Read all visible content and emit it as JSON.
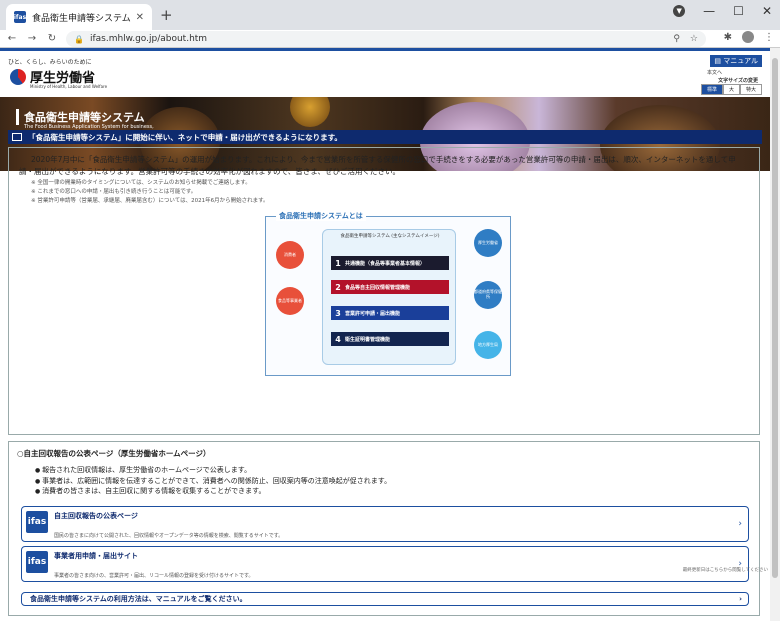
{
  "browser": {
    "tab_title": "食品衛生申請等システム",
    "url": "ifas.mhlw.go.jp/about.htm",
    "favicon_text": "ifas"
  },
  "header": {
    "tagline": "ひと、くらし、みらいのために",
    "logo_name": "厚生労働省",
    "logo_en": "Ministry of Health, Labour and Welfare",
    "manual": "マニュアル",
    "honbun": "本文へ",
    "font_size_label": "文字サイズの変更",
    "sizes": [
      "標準",
      "大",
      "特大"
    ]
  },
  "banner": {
    "title": "食品衛生申請等システム",
    "sub": "The Food Business Application System for business, expert certificates and report of food recall"
  },
  "notice": "「食品衛生申請等システム」に開始に伴い、ネットで申請・届け出ができるようになります。",
  "intro": "2020年7月中に「食品衛生申請等システム」の運用が始まります。これにより、今まで営業所を所管する保健所の窓口で手続きをする必要があった営業許可等の申請・届出は、順次、インターネットを通して申請・届出ができるようになります。営業許可等の手続きの効率化が図れますので、皆さま、ぜひご活用ください。",
  "notes": [
    "※ 全国一律の開業時のタイミングについては、システムのお知らせ掲載でご連絡します。",
    "※ これまでの窓口への申請・届出も引き続き行うことは可能です。",
    "※ 営業許可申請等（営業届、承継届、廃業届含む）については、2021年6月から開始されます。"
  ],
  "diagram": {
    "title": "食品衛生申請システムとは",
    "panel_title": "食品衛生申請等システム\n(主なシステムイメージ)",
    "rows": [
      {
        "n": "1",
        "label": "共通機能（食品等事業者基本情報）"
      },
      {
        "n": "2",
        "label": "食品等自主回収情報管理機能"
      },
      {
        "n": "3",
        "label": "営業許可申請・届出機能"
      },
      {
        "n": "4",
        "label": "衛生証明書管理機能"
      }
    ],
    "circles": [
      "消費者",
      "食品等事業者",
      "厚生労働省",
      "都道府県等保健所",
      "地方厚生局"
    ],
    "colors": {
      "row1": "#1b1b2e",
      "row2": "#b3122a",
      "row3": "#1a3f9a",
      "row4": "#13254f"
    }
  },
  "section2": {
    "title": "○自主回収報告の公表ページ（厚生労働省ホームページ）",
    "bullets": [
      "報告された回収情報は、厚生労働省のホームページで公表します。",
      "事業者は、広範囲に情報を伝達することができて、消費者への関係防止、回収案内等の注意喚起が促されます。",
      "消費者の皆さまは、自主回収に関する情報を収集することができます。"
    ]
  },
  "cards": [
    {
      "title": "自主回収報告の公表ページ",
      "desc": "国民の皆さまに向けて公開された、回収情報やオープンデータ等の情報を検索、閲覧するサイトです。"
    },
    {
      "title": "事業者用申請・届出サイト",
      "desc": "事業者の皆さま向けの、営業許可・届出、リコール情報の登録を受け付けるサイトです。"
    }
  ],
  "manual_link": "食品衛生申請等システムの利用方法は、マニュアルをご覧ください。",
  "footnote": "最終更新日はこちらから閲覧してください"
}
